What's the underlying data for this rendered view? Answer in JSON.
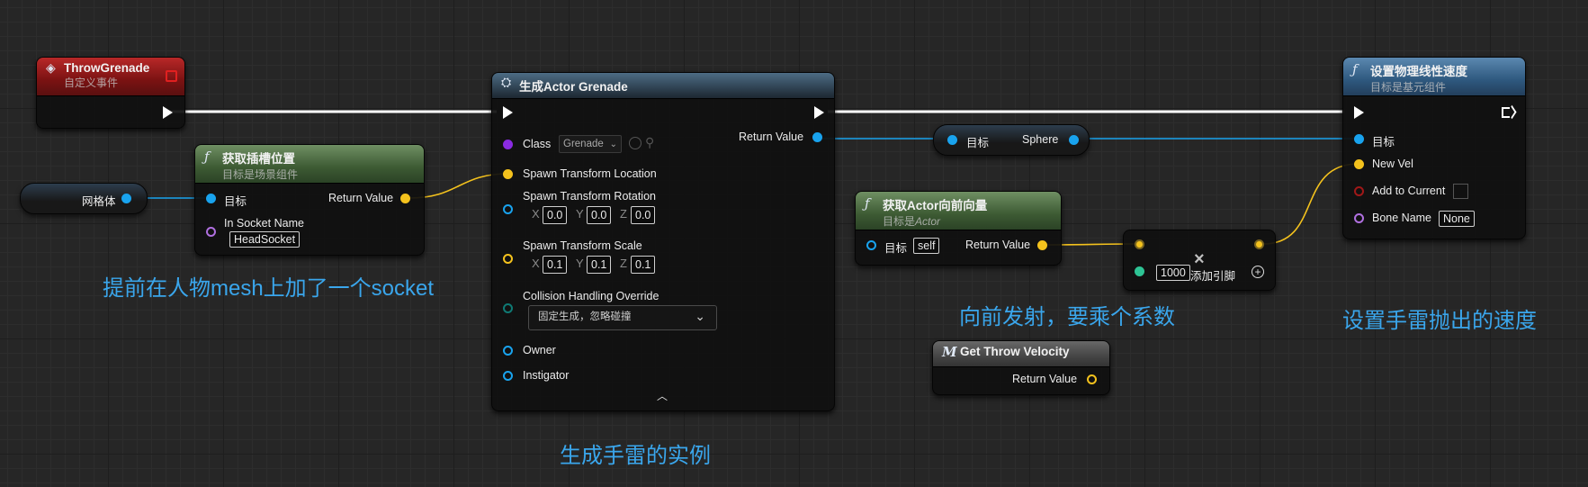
{
  "nodes": {
    "throw_grenade": {
      "title": "ThrowGrenade",
      "subtitle": "自定义事件"
    },
    "get_socket": {
      "title": "获取插槽位置",
      "subtitle": "目标是场景组件",
      "target_label": "目标",
      "socket_name_label": "In Socket Name",
      "socket_name_value": "HeadSocket",
      "return_label": "Return Value"
    },
    "mesh_var": {
      "label": "网格体"
    },
    "spawn_actor": {
      "title": "生成Actor Grenade",
      "class_label": "Class",
      "class_value": "Grenade",
      "location_label": "Spawn Transform Location",
      "rotation_label": "Spawn Transform Rotation",
      "rotation": {
        "x": "0.0",
        "y": "0.0",
        "z": "0.0"
      },
      "scale_label": "Spawn Transform Scale",
      "scale": {
        "x": "0.1",
        "y": "0.1",
        "z": "0.1"
      },
      "collision_label": "Collision Handling Override",
      "collision_value": "固定生成，忽略碰撞",
      "owner_label": "Owner",
      "instigator_label": "Instigator",
      "return_label": "Return Value",
      "axis_x": "X",
      "axis_y": "Y",
      "axis_z": "Z"
    },
    "cast_sphere": {
      "target_label": "目标",
      "component_label": "Sphere"
    },
    "forward_vector": {
      "title": "获取Actor向前向量",
      "subtitle_prefix": "目标是",
      "subtitle_class": "Actor",
      "target_label": "目标",
      "target_value": "self",
      "return_label": "Return Value"
    },
    "multiply": {
      "factor": "1000",
      "add_pin_label": "添加引脚"
    },
    "get_velocity": {
      "title": "Get Throw Velocity",
      "return_label": "Return Value"
    },
    "set_velocity": {
      "title": "设置物理线性速度",
      "subtitle": "目标是基元组件",
      "target_label": "目标",
      "new_vel_label": "New Vel",
      "add_current_label": "Add to Current",
      "bone_name_label": "Bone Name",
      "bone_name_value": "None"
    }
  },
  "comments": {
    "socket_note": "提前在人物mesh上加了一个socket",
    "spawn_note": "生成手雷的实例",
    "forward_note": "向前发射，要乘个系数",
    "velocity_note": "设置手雷抛出的速度"
  },
  "colors": {
    "exec": "#ffffff",
    "object_pin": "#19a3ee",
    "vector_pin": "#f4c21d",
    "comment_text": "#3aa6ec",
    "event_header": "#b82828",
    "pure_header": "#6f8f63",
    "function_header": "#5b88b0"
  },
  "icons": [
    "event-diamond-icon",
    "function-icon",
    "spawn-icon",
    "macro-icon",
    "close-icon",
    "add-pin-icon",
    "chevron-down-icon",
    "chevron-up-icon",
    "browse-icon",
    "search-icon"
  ]
}
